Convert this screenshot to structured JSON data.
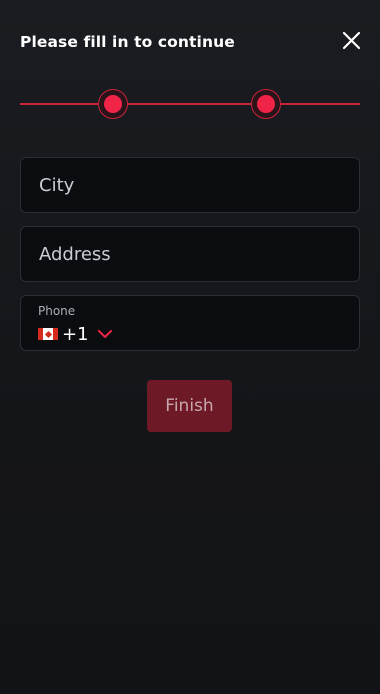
{
  "header": {
    "title": "Please fill in to continue",
    "close_icon": "close-icon"
  },
  "stepper": {
    "steps_total": 2,
    "current_step": 2,
    "accent_color": "#ef2446"
  },
  "form": {
    "city": {
      "placeholder": "City",
      "value": ""
    },
    "address": {
      "placeholder": "Address",
      "value": ""
    },
    "phone": {
      "label": "Phone",
      "country_flag_icon": "canada-flag-icon",
      "dial_code": "+1",
      "dropdown_icon": "chevron-down-icon"
    },
    "finish_label": "Finish",
    "finish_disabled": true
  },
  "colors": {
    "background": "#16171b",
    "field_background": "#0b0c0f",
    "accent": "#ef2446",
    "button_disabled": "#6e1a26"
  }
}
